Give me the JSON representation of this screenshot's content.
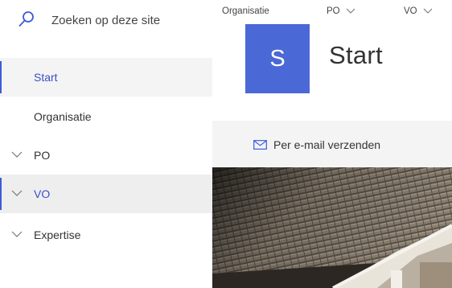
{
  "search": {
    "placeholder": "Zoeken op deze site"
  },
  "sidebar": {
    "items": [
      {
        "label": "Start"
      },
      {
        "label": "Organisatie"
      },
      {
        "label": "PO"
      },
      {
        "label": "VO"
      },
      {
        "label": "Expertise"
      }
    ]
  },
  "topnav": {
    "items": [
      {
        "label": "Organisatie"
      },
      {
        "label": "PO"
      },
      {
        "label": "VO"
      }
    ]
  },
  "site": {
    "logo_letter": "S",
    "title": "Start"
  },
  "commandbar": {
    "email_label": "Per e-mail verzenden"
  },
  "icons": {
    "search": "search-icon",
    "chevron": "chevron-down-icon",
    "mail": "mail-icon"
  },
  "colors": {
    "accent": "#3b5bdb",
    "logo_bg": "#4a68d6",
    "selected_bg": "#f4f4f4",
    "active_bg": "#eeeeee"
  }
}
